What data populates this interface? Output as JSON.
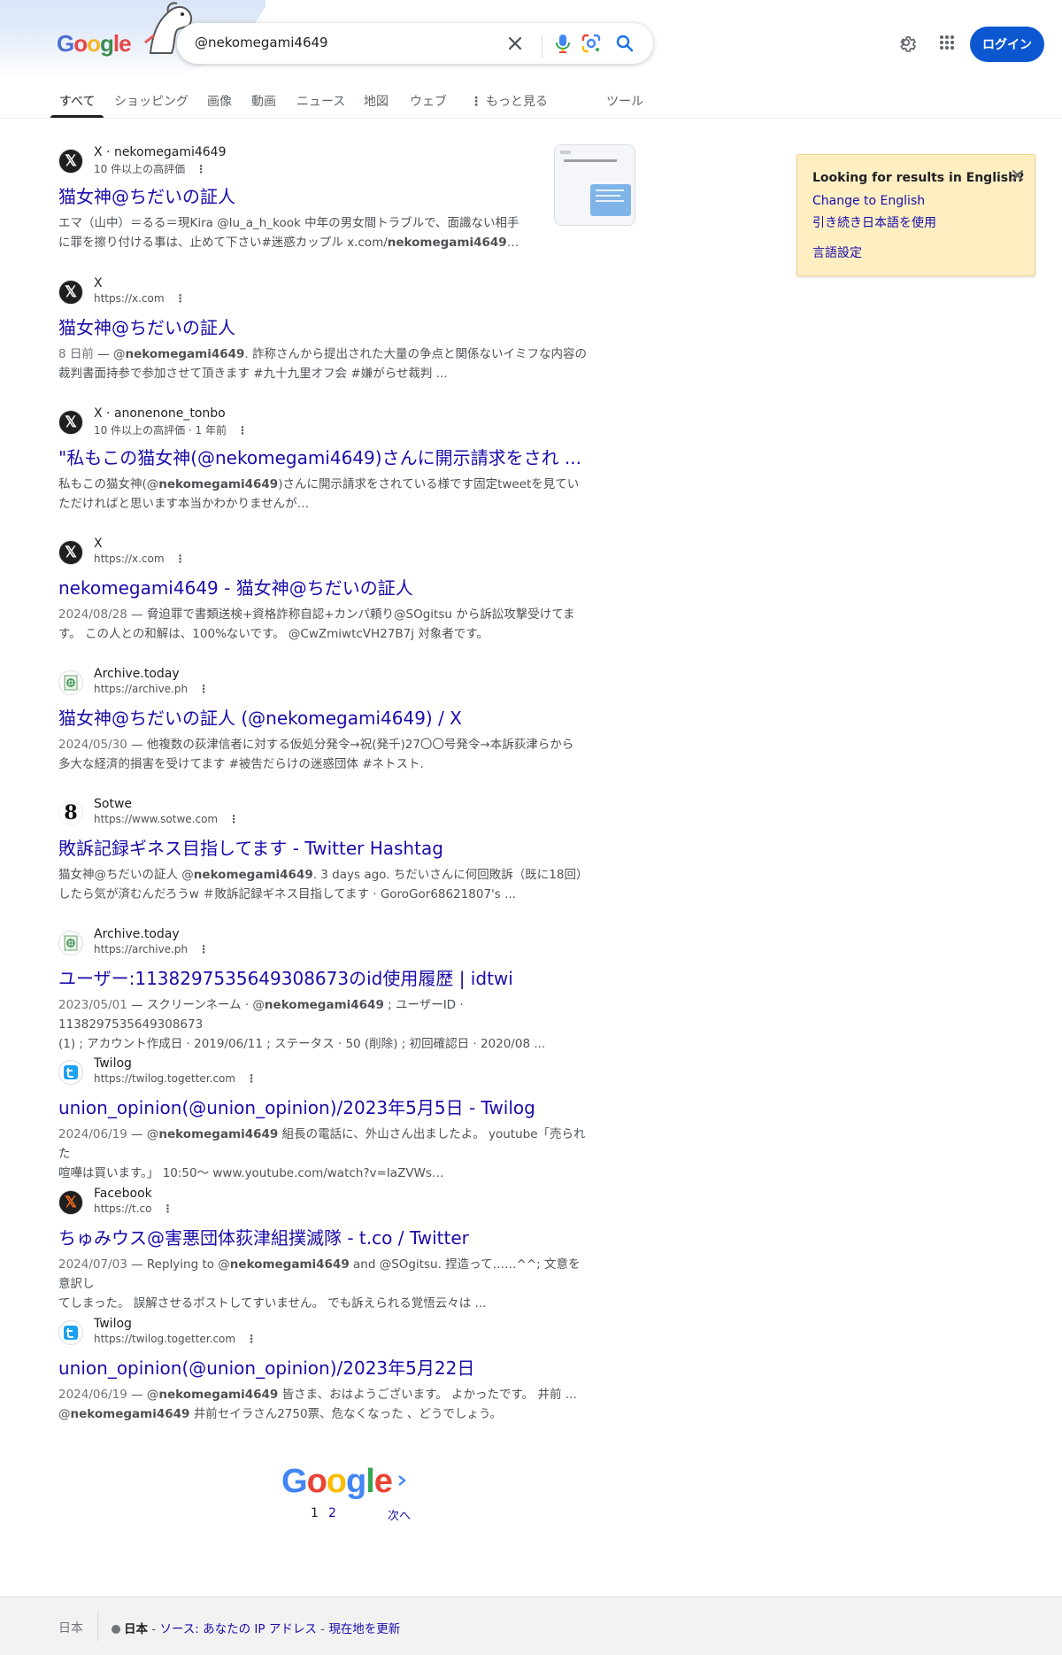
{
  "search": {
    "query": "@nekomegami4649"
  },
  "doodle": {
    "logo_letters": [
      "G",
      "o",
      "o",
      "g",
      "le"
    ]
  },
  "header": {
    "login_label": "ログイン"
  },
  "tabs": [
    {
      "label": "すべて",
      "active": true
    },
    {
      "label": "ショッピング"
    },
    {
      "label": "画像"
    },
    {
      "label": "動画"
    },
    {
      "label": "ニュース"
    },
    {
      "label": "地図"
    },
    {
      "label": "ウェブ"
    },
    {
      "label": "もっと見る"
    },
    {
      "label": "ツール"
    }
  ],
  "results": [
    {
      "favicon": "x-icon",
      "site": "X · nekomegami4649",
      "meta": "10 件以上の高評価",
      "title": "猫女神@ちだいの証人",
      "snippet_line1": "エマ（山中）＝るる＝現Kira @lu_a_h_kook 中年の男女間トラブルで、面識ない相手",
      "snippet_line2_pre": "に罪を擦り付ける事は、止めて下さい#迷惑カップル x.com/",
      "snippet_line2_bold": "nekomegami4649",
      "snippet_line2_post": "…"
    },
    {
      "favicon": "x-icon",
      "site": "X",
      "meta": "https://x.com",
      "title": "猫女神@ちだいの証人",
      "date": "8 日前",
      "snippet_line1_pre": " — @",
      "snippet_line1_bold": "nekomegami4649",
      "snippet_line1_post": ". 詐称さんから提出された大量の争点と関係ないイミフな内容の",
      "snippet_line2": "裁判書面持参で参加させて頂きます #九十九里オフ会 #嫌がらせ裁判 ..."
    },
    {
      "favicon": "x-icon",
      "site": "X · anonenone_tonbo",
      "meta": "10 件以上の高評価 · 1 年前",
      "title": "\"私もこの猫女神(@nekomegami4649)さんに開示請求をされ ...",
      "snippet_line1_pre": "私もこの猫女神(@",
      "snippet_line1_bold": "nekomegami4649",
      "snippet_line1_post": ")さんに開示請求をされている様です固定tweetを見てい",
      "snippet_line2": "ただければと思います本当かわかりませんが…"
    },
    {
      "favicon": "x-icon",
      "site": "X",
      "meta": "https://x.com",
      "title": "nekomegami4649 - 猫女神@ちだいの証人",
      "date": "2024/08/28",
      "snippet_line1": " — 脅迫罪で書類送検+資格詐称自認+カンパ頼り@SOgitsu から訴訟攻撃受けてま",
      "snippet_line2": "す。 この人との和解は、100%ないです。 @CwZmiwtcVH27B7j 対象者です。"
    },
    {
      "favicon": "archive-icon",
      "site": "Archive.today",
      "meta": "https://archive.ph",
      "title": "猫女神@ちだいの証人 (@nekomegami4649) / X",
      "date": "2024/05/30",
      "snippet_line1": " — 他複数の荻津信者に対する仮処分発令→祝(発千)27〇〇号発令→本訴荻津らから",
      "snippet_line2": "多大な経済的損害を受けてます #被告だらけの迷惑団体 #ネトスト."
    },
    {
      "favicon": "sotwe-icon",
      "site": "Sotwe",
      "meta": "https://www.sotwe.com",
      "title": "敗訴記録ギネス目指してます - Twitter Hashtag",
      "snippet_line1_pre": "猫女神@ちだいの証人 @",
      "snippet_line1_bold": "nekomegami4649",
      "snippet_line1_post": ". 3 days ago. ちだいさんに何回敗訴（既に18回）",
      "snippet_line2": "したら気が済むんだろうw ＃敗訴記録ギネス目指してます · GoroGor68621807's ..."
    },
    {
      "favicon": "archive-icon",
      "site": "Archive.today",
      "meta": "https://archive.ph",
      "title": "ユーザー:1138297535649308673のid使用履歴 | idtwi",
      "date": "2023/05/01",
      "snippet_line1_pre": " — スクリーンネーム · @",
      "snippet_line1_bold": "nekomegami4649",
      "snippet_line1_post": " ; ユーザーID · 1138297535649308673",
      "snippet_line2": "(1) ; アカウント作成日 · 2019/06/11 ; ステータス · 50 (削除) ; 初回確認日 · 2020/08 ..."
    },
    {
      "favicon": "twilog-icon",
      "site": "Twilog",
      "meta": "https://twilog.togetter.com",
      "title": "union_opinion(@union_opinion)/2023年5月5日 - Twilog",
      "date": "2024/06/19",
      "snippet_line1_pre": " — @",
      "snippet_line1_bold": "nekomegami4649",
      "snippet_line1_post": " 組長の電話に、外山さん出ましたよ。 youtube「売られた",
      "snippet_line2": "喧嘩は買います。」 10:50〜 www.youtube.com/watch?v=IaZVWs…"
    },
    {
      "favicon": "facebook-icon",
      "site": "Facebook",
      "meta": "https://t.co",
      "title": "ちゅみウス@害悪団体荻津組撲滅隊 - t.co / Twitter",
      "date": "2024/07/03",
      "snippet_line1_pre": " — Replying to @",
      "snippet_line1_bold": "nekomegami4649",
      "snippet_line1_post": " and @SOgitsu. 捏造って……^^; 文意を意訳し",
      "snippet_line2": "てしまった。 誤解させるポストしてすいません。 でも訴えられる覚悟云々は ..."
    },
    {
      "favicon": "twilog-icon",
      "site": "Twilog",
      "meta": "https://twilog.togetter.com",
      "title": "union_opinion(@union_opinion)/2023年5月22日",
      "date": "2024/06/19",
      "snippet_line1_pre": " — @",
      "snippet_line1_bold": "nekomegami4649",
      "snippet_line1_post": " 皆さま、おはようございます。 よかったです。 井前 ...",
      "snippet_line2_pre": "@",
      "snippet_line2_bold": "nekomegami4649",
      "snippet_line2_post": " 井前セイラさん2750票、危なくなった 、どうでしょう。"
    }
  ],
  "english_panel": {
    "title": "Looking for results in English?",
    "change": "Change to English",
    "keep": "引き続き日本語を使用",
    "settings": "言語設定"
  },
  "pagination": {
    "logo": [
      "G",
      "o",
      "o",
      "g",
      "l",
      "e"
    ],
    "current": "1",
    "page2": "2",
    "next": "次へ"
  },
  "footer": {
    "country": "日本",
    "region": "日本",
    "source": "ソース: あなたの IP アドレス",
    "update": "現在地を更新"
  },
  "colors": {
    "link": "#1a0dab",
    "accent": "#0b57d0",
    "panel_bg": "#feefc3"
  }
}
